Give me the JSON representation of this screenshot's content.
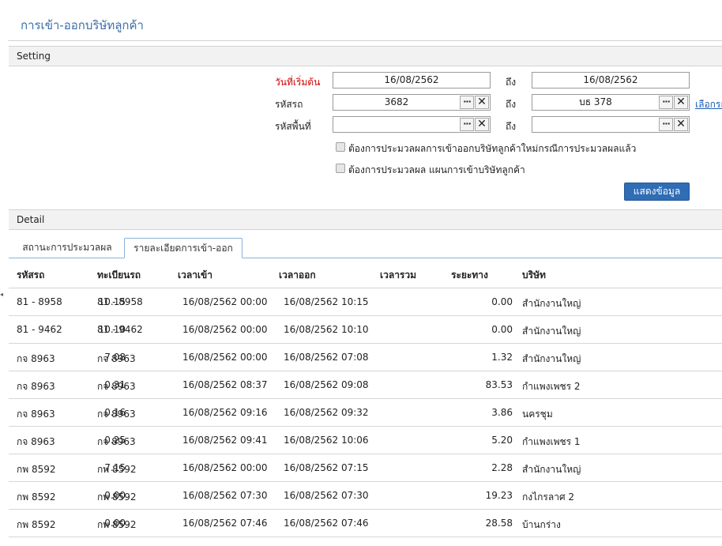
{
  "page": {
    "title": "การเข้า-ออกบริษัทลูกค้า"
  },
  "setting": {
    "header": "Setting",
    "to_label": "ถึง",
    "start_date": {
      "label": "วันที่เริ่มต้น",
      "from": "16/08/2562",
      "to": "16/08/2562"
    },
    "vehicle": {
      "label": "รหัสรถ",
      "from": "3682",
      "to": "บธ 378",
      "select_link": "เลือกรถ"
    },
    "area": {
      "label": "รหัสพื้นที่",
      "from": "",
      "to": ""
    },
    "checkboxes": [
      {
        "label": "ต้องการประมวลผลการเข้าออกบริษัทลูกค้าใหม่กรณีการประมวลผลแล้ว",
        "checked": false
      },
      {
        "label": "ต้องการประมวลผล แผนการเข้าบริษัทลูกค้า",
        "checked": false
      }
    ],
    "show_button": "แสดงข้อมูล",
    "browse_glyph": "···",
    "clear_glyph": "✕"
  },
  "detail": {
    "header": "Detail",
    "tabs": [
      {
        "label": "สถานะการประมวลผล",
        "active": false
      },
      {
        "label": "รายละเอียดการเข้า-ออก",
        "active": true
      }
    ],
    "columns": [
      "รหัสรถ",
      "ทะเบียนรถ",
      "เวลาเข้า",
      "เวลาออก",
      "เวลารวม",
      "ระยะทาง",
      "บริษัท"
    ],
    "rows": [
      [
        "81 - 8958",
        "81 - 8958",
        "16/08/2562 00:00",
        "16/08/2562 10:15",
        "10.15",
        "0.00",
        "สำนักงานใหญ่"
      ],
      [
        "81 - 9462",
        "81 - 9462",
        "16/08/2562 00:00",
        "16/08/2562 10:10",
        "10.10",
        "0.00",
        "สำนักงานใหญ่"
      ],
      [
        "กจ 8963",
        "กจ 8963",
        "16/08/2562 00:00",
        "16/08/2562 07:08",
        "7.08",
        "1.32",
        "สำนักงานใหญ่"
      ],
      [
        "กจ 8963",
        "กจ 8963",
        "16/08/2562 08:37",
        "16/08/2562 09:08",
        "0.31",
        "83.53",
        "กำแพงเพชร 2"
      ],
      [
        "กจ 8963",
        "กจ 8963",
        "16/08/2562 09:16",
        "16/08/2562 09:32",
        "0.16",
        "3.86",
        "นครชุม"
      ],
      [
        "กจ 8963",
        "กจ 8963",
        "16/08/2562 09:41",
        "16/08/2562 10:06",
        "0.25",
        "5.20",
        "กำแพงเพชร 1"
      ],
      [
        "กพ 8592",
        "กพ 8592",
        "16/08/2562 00:00",
        "16/08/2562 07:15",
        "7.15",
        "2.28",
        "สำนักงานใหญ่"
      ],
      [
        "กพ 8592",
        "กพ 8592",
        "16/08/2562 07:30",
        "16/08/2562 07:30",
        "0.00",
        "19.23",
        "กงไกรลาศ 2"
      ],
      [
        "กพ 8592",
        "กพ 8592",
        "16/08/2562 07:46",
        "16/08/2562 07:46",
        "0.00",
        "28.58",
        "บ้านกร่าง"
      ]
    ]
  }
}
